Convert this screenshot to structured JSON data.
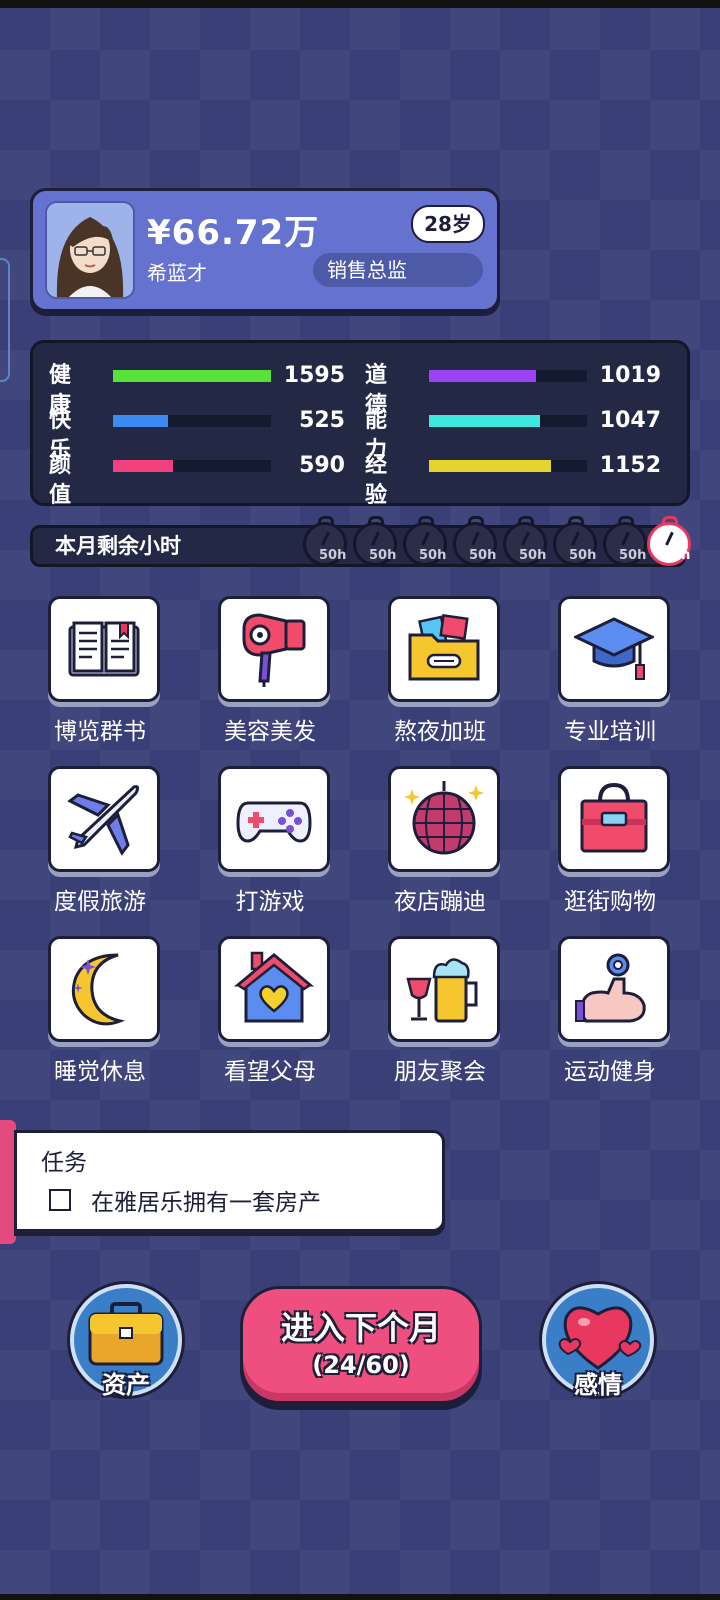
{
  "profile": {
    "money": "¥66.72万",
    "name": "希蓝才",
    "age": "28岁",
    "job": "销售总监"
  },
  "stats": [
    {
      "label": "健康",
      "value": "1595",
      "level": 1.0,
      "color": "#59e23b"
    },
    {
      "label": "快乐",
      "value": "525",
      "level": 0.35,
      "color": "#3b8bf2"
    },
    {
      "label": "颜值",
      "value": "590",
      "level": 0.38,
      "color": "#f2417d"
    },
    {
      "label": "道德",
      "value": "1019",
      "level": 0.68,
      "color": "#9b42f5"
    },
    {
      "label": "能力",
      "value": "1047",
      "level": 0.7,
      "color": "#3ee8df"
    },
    {
      "label": "经验",
      "value": "1152",
      "level": 0.77,
      "color": "#e6d42e"
    }
  ],
  "hours": {
    "label": "本月剩余小时",
    "clocks": [
      "50h",
      "50h",
      "50h",
      "50h",
      "50h",
      "50h",
      "50h",
      "50h"
    ]
  },
  "activities": [
    {
      "label": "博览群书",
      "icon": "book-icon"
    },
    {
      "label": "美容美发",
      "icon": "hair-dryer-icon"
    },
    {
      "label": "熬夜加班",
      "icon": "folder-icon"
    },
    {
      "label": "专业培训",
      "icon": "graduation-cap-icon"
    },
    {
      "label": "度假旅游",
      "icon": "airplane-icon"
    },
    {
      "label": "打游戏",
      "icon": "gamepad-icon"
    },
    {
      "label": "夜店蹦迪",
      "icon": "disco-ball-icon"
    },
    {
      "label": "逛街购物",
      "icon": "shopping-bag-icon"
    },
    {
      "label": "睡觉休息",
      "icon": "moon-icon"
    },
    {
      "label": "看望父母",
      "icon": "house-heart-icon"
    },
    {
      "label": "朋友聚会",
      "icon": "drinks-icon"
    },
    {
      "label": "运动健身",
      "icon": "muscle-icon"
    }
  ],
  "task": {
    "title": "任务",
    "item": "在雅居乐拥有一套房产"
  },
  "buttons": {
    "assets": "资产",
    "next_main": "进入下个月",
    "next_sub": "(24/60)",
    "love": "感情"
  }
}
